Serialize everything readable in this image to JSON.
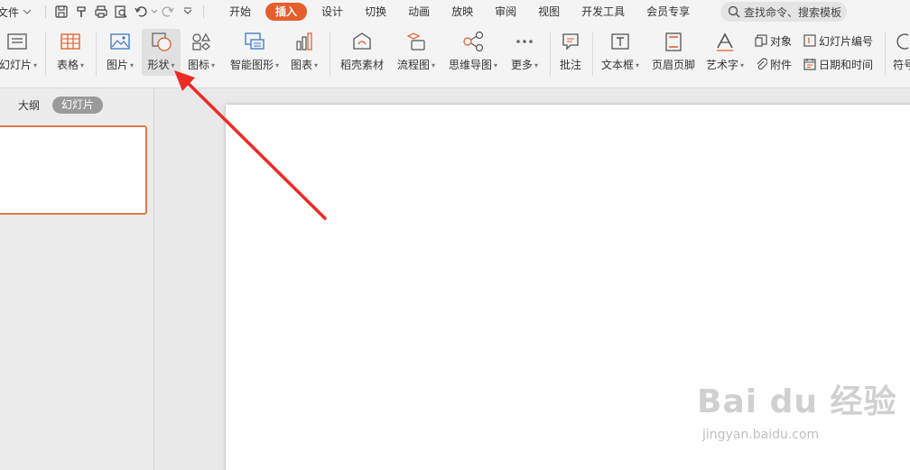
{
  "menubar": {
    "file_label": "文件",
    "tabs": [
      "开始",
      "插入",
      "设计",
      "切换",
      "动画",
      "放映",
      "审阅",
      "视图",
      "开发工具",
      "会员专享"
    ],
    "active_tab": "插入",
    "search_text": "查找命令、搜索模板"
  },
  "ribbon": {
    "new_slide": "幻灯片",
    "table": "表格",
    "picture": "图片",
    "shape": "形状",
    "icon": "图标",
    "smartart": "智能图形",
    "chart": "图表",
    "material": "稻壳素材",
    "flowchart": "流程图",
    "mindmap": "思维导图",
    "more": "更多",
    "comment": "批注",
    "textbox": "文本框",
    "header_footer": "页眉页脚",
    "wordart": "艺术字",
    "object": "对象",
    "attachment": "附件",
    "slide_number": "幻灯片编号",
    "date_time": "日期和时间",
    "symbol": "符号"
  },
  "leftpanel": {
    "outline_tab": "大纲",
    "slides_tab": "幻灯片"
  },
  "watermark": {
    "brand": "Bai du 经验",
    "url": "jingyan.baidu.com"
  },
  "colors": {
    "accent": "#e45f2b",
    "arrow": "#ee2a24",
    "selection": "#e07a42"
  }
}
